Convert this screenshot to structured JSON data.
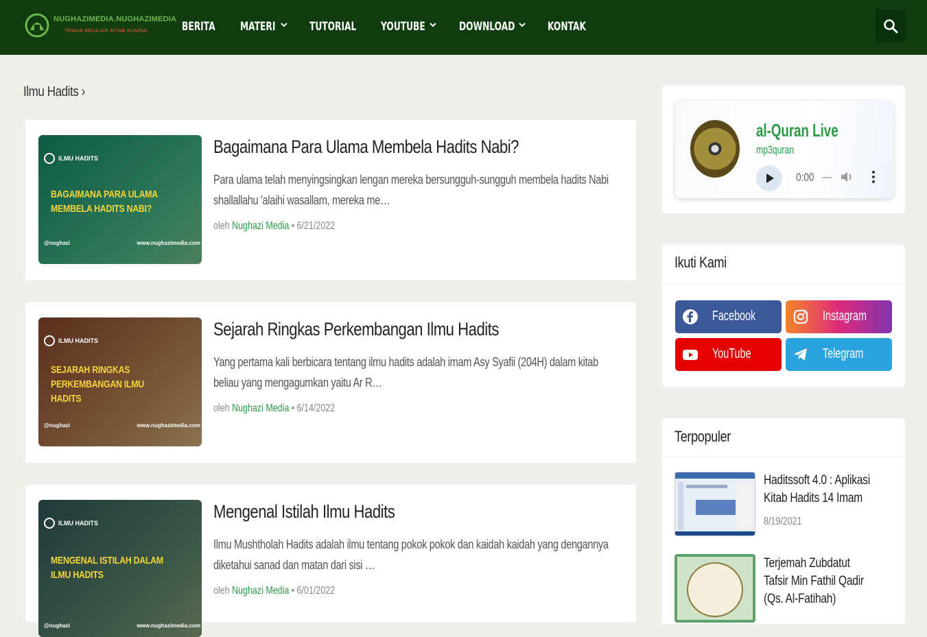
{
  "site": {
    "logo_title": "NUGHAZIMEDIA.NUGHAZIMEDIA",
    "logo_tagline": "TEMAN BELAJAR KITAB KUNING",
    "colors": {
      "navbar": "#0f3d10",
      "accent_green": "#2b9a47",
      "thumb_text": "#f5d43a"
    }
  },
  "nav": {
    "items": [
      {
        "label": "BERITA",
        "dropdown": false
      },
      {
        "label": "MATERI",
        "dropdown": true
      },
      {
        "label": "TUTORIAL",
        "dropdown": false
      },
      {
        "label": "YOUTUBE",
        "dropdown": true
      },
      {
        "label": "DOWNLOAD",
        "dropdown": true
      },
      {
        "label": "KONTAK",
        "dropdown": false
      }
    ],
    "search_icon": "search-icon"
  },
  "breadcrumb": {
    "label": "Ilmu Hadits",
    "separator": "›"
  },
  "posts": [
    {
      "thumb_badge": "ILMU HADITS",
      "thumb_title_lines": [
        "BAGAIMANA PARA ULAMA",
        "MEMBELA HADITS NABI?"
      ],
      "thumb_handle": "@nughazi",
      "thumb_site": "www.nughazimedia.com",
      "title": "Bagaimana Para Ulama Membela Hadits Nabi?",
      "excerpt": "Para ulama telah menyingsingkan lengan mereka bersungguh-sungguh membela hadits Nabi shallallahu 'alaihi wasallam, mereka me…",
      "author_prefix": "oleh",
      "author": "Nughazi Media",
      "date": "6/21/2022",
      "colors": {
        "bg1": "#0e5a44",
        "bg2": "#2f7a5a"
      }
    },
    {
      "thumb_badge": "ILMU HADITS",
      "thumb_title_lines": [
        "SEJARAH RINGKAS",
        "PERKEMBANGAN ILMU",
        "HADITS"
      ],
      "thumb_handle": "@nughazi",
      "thumb_site": "www.nughazimedia.com",
      "title": "Sejarah Ringkas Perkembangan Ilmu Hadits",
      "excerpt": "Yang pertama kali berbicara tentang ilmu hadits adalah imam Asy Syafii (204H) dalam kitab beliau yang mengagumkan yaitu Ar R…",
      "author_prefix": "oleh",
      "author": "Nughazi Media",
      "date": "6/14/2022",
      "colors": {
        "bg1": "#5a2e1c",
        "bg2": "#7a5a3a"
      }
    },
    {
      "thumb_badge": "ILMU HADITS",
      "thumb_title_lines": [
        "MENGENAL ISTILAH DALAM",
        "ILMU HADITS"
      ],
      "thumb_handle": "@nughazi",
      "thumb_site": "www.nughazimedia.com",
      "title": "Mengenal Istilah Ilmu Hadits",
      "excerpt": "Ilmu Mushtholah Hadits adalah ilmu tentang pokok pokok dan kaidah kaidah yang dengannya diketahui sanad dan matan dari sisi …",
      "author_prefix": "oleh",
      "author": "Nughazi Media",
      "date": "6/01/2022",
      "colors": {
        "bg1": "#1f3a3a",
        "bg2": "#3e5a48"
      }
    }
  ],
  "sidebar": {
    "audio": {
      "title": "al-Quran Live",
      "subtitle": "mp3quran",
      "time": "0:00",
      "icons": [
        "play-icon",
        "volume-icon",
        "more-vertical-icon"
      ]
    },
    "follow": {
      "heading": "Ikuti Kami",
      "buttons": [
        {
          "label": "Facebook",
          "icon": "facebook-icon",
          "color": "#3b5998"
        },
        {
          "label": "Instagram",
          "icon": "instagram-icon",
          "color": "#d6249f"
        },
        {
          "label": "YouTube",
          "icon": "youtube-icon",
          "color": "#e60000"
        },
        {
          "label": "Telegram",
          "icon": "telegram-icon",
          "color": "#2aa3de"
        }
      ]
    },
    "popular": {
      "heading": "Terpopuler",
      "items": [
        {
          "title_lines": [
            "Haditssoft 4.0 : Aplikasi",
            "Kitab Hadits 14 Imam"
          ],
          "date": "8/19/2021"
        },
        {
          "title_lines": [
            "Terjemah Zubdatut",
            "Tafsir Min Fathil Qadir",
            "(Qs. Al-Fatihah)"
          ],
          "date": ""
        }
      ]
    }
  }
}
